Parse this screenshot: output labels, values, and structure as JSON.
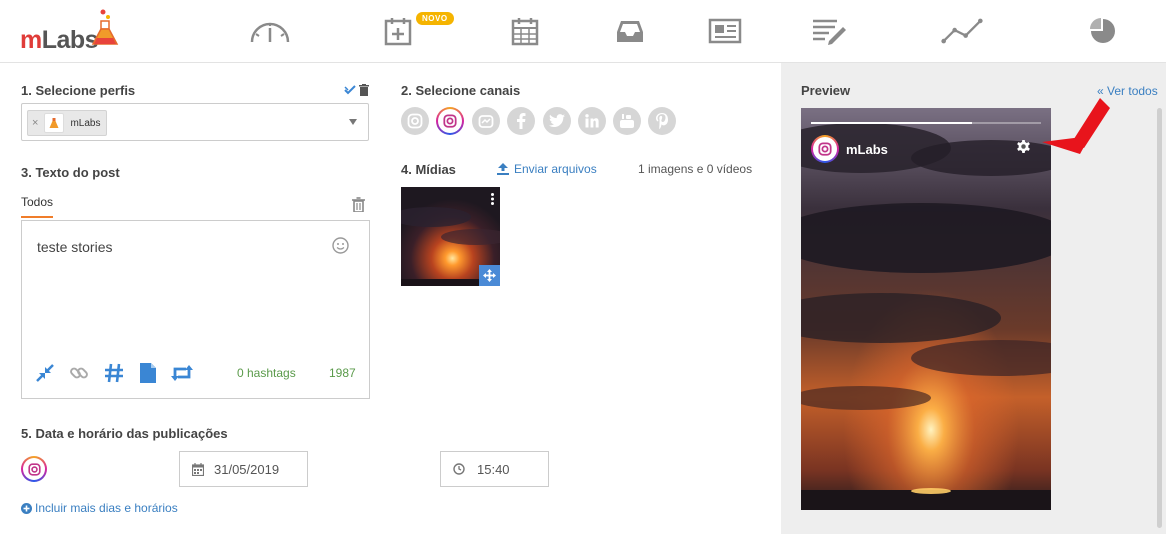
{
  "brand": {
    "name_m": "m",
    "name_rest": "Labs"
  },
  "nav": {
    "items": [
      {
        "name": "dashboard-gauge-icon"
      },
      {
        "name": "calendar-plus-icon"
      },
      {
        "name": "calendar-grid-icon"
      },
      {
        "name": "inbox-icon"
      },
      {
        "name": "newspaper-icon"
      },
      {
        "name": "edit-list-icon"
      },
      {
        "name": "line-chart-icon"
      },
      {
        "name": "pie-chart-icon"
      }
    ],
    "badge_novo": "NOVO"
  },
  "section1": {
    "title": "1. Selecione perfis",
    "chip_label": "mLabs",
    "chip_remove": "×"
  },
  "section2": {
    "title": "2. Selecione canais",
    "channels": [
      "instagram",
      "instagram-stories",
      "igtv",
      "facebook",
      "twitter",
      "linkedin",
      "youtube",
      "pinterest"
    ]
  },
  "section3": {
    "title": "3. Texto do post",
    "tab": "Todos",
    "text": "teste stories",
    "hashtags": "0 hashtags",
    "char_count": "1987"
  },
  "section4": {
    "title": "4. Mídias",
    "upload_label": "Enviar arquivos",
    "media_count": "1 imagens e 0 vídeos"
  },
  "section5": {
    "title": "5. Data e horário das publicações",
    "date": "31/05/2019",
    "time": "15:40",
    "more_link": "Incluir mais dias e horários"
  },
  "preview": {
    "title": "Preview",
    "ver_todos": "Ver todos",
    "profile_name": "mLabs",
    "story_progress": 0.7
  },
  "colors": {
    "accent_orange": "#f07d2a",
    "link_blue": "#3a7fc1",
    "tool_blue": "#3a86d4",
    "green_text": "#5a9a4a",
    "badge_yellow": "#f5b400",
    "arrow_red": "#e8141c"
  }
}
